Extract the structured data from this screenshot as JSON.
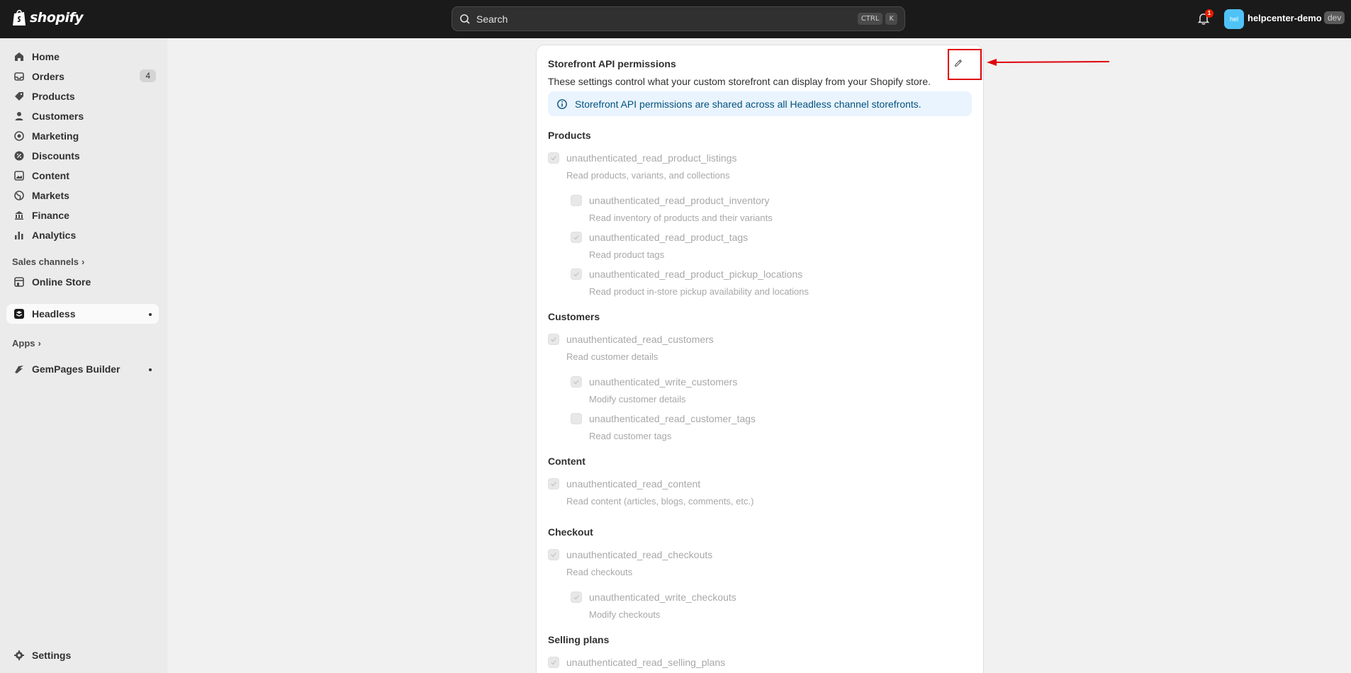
{
  "topbar": {
    "logo_text": "shopify",
    "search_placeholder": "Search",
    "shortcut_keys": [
      "CTRL",
      "K"
    ],
    "notification_count": "1",
    "avatar_initials": "hel",
    "store_name": "helpcenter-demo",
    "dev_badge": "dev"
  },
  "sidebar": {
    "items": [
      {
        "label": "Home",
        "icon": "home-icon"
      },
      {
        "label": "Orders",
        "icon": "inbox-icon",
        "count": "4"
      },
      {
        "label": "Products",
        "icon": "tag-icon"
      },
      {
        "label": "Customers",
        "icon": "person-icon"
      },
      {
        "label": "Marketing",
        "icon": "target-icon"
      },
      {
        "label": "Discounts",
        "icon": "discount-icon"
      },
      {
        "label": "Content",
        "icon": "image-icon"
      },
      {
        "label": "Markets",
        "icon": "globe-icon"
      },
      {
        "label": "Finance",
        "icon": "bank-icon"
      },
      {
        "label": "Analytics",
        "icon": "bar-chart-icon"
      }
    ],
    "sales_channels_label": "Sales channels",
    "online_store_label": "Online Store",
    "headless_label": "Headless",
    "apps_label": "Apps",
    "gempages_label": "GemPages Builder",
    "settings_label": "Settings"
  },
  "card": {
    "title": "Storefront API permissions",
    "description": "These settings control what your custom storefront can display from your Shopify store.",
    "info_banner": "Storefront API permissions are shared across all Headless channel storefronts.",
    "groups": [
      {
        "title": "Products",
        "perms": [
          {
            "name": "unauthenticated_read_product_listings",
            "desc": "Read products, variants, and collections",
            "checked": true,
            "indent": false
          },
          {
            "name": "unauthenticated_read_product_inventory",
            "desc": "Read inventory of products and their variants",
            "checked": false,
            "indent": true
          },
          {
            "name": "unauthenticated_read_product_tags",
            "desc": "Read product tags",
            "checked": true,
            "indent": true
          },
          {
            "name": "unauthenticated_read_product_pickup_locations",
            "desc": "Read product in-store pickup availability and locations",
            "checked": true,
            "indent": true
          }
        ]
      },
      {
        "title": "Customers",
        "perms": [
          {
            "name": "unauthenticated_read_customers",
            "desc": "Read customer details",
            "checked": true,
            "indent": false
          },
          {
            "name": "unauthenticated_write_customers",
            "desc": "Modify customer details",
            "checked": true,
            "indent": true
          },
          {
            "name": "unauthenticated_read_customer_tags",
            "desc": "Read customer tags",
            "checked": false,
            "indent": true
          }
        ]
      },
      {
        "title": "Content",
        "perms": [
          {
            "name": "unauthenticated_read_content",
            "desc": "Read content (articles, blogs, comments, etc.)",
            "checked": true,
            "indent": false
          }
        ]
      },
      {
        "title": "Checkout",
        "perms": [
          {
            "name": "unauthenticated_read_checkouts",
            "desc": "Read checkouts",
            "checked": true,
            "indent": false
          },
          {
            "name": "unauthenticated_write_checkouts",
            "desc": "Modify checkouts",
            "checked": true,
            "indent": true
          }
        ]
      },
      {
        "title": "Selling plans",
        "perms": [
          {
            "name": "unauthenticated_read_selling_plans",
            "desc": "",
            "checked": true,
            "indent": false
          }
        ]
      }
    ]
  },
  "colors": {
    "topbar_bg": "#1a1a1a",
    "annotation_red": "#e0000a",
    "info_bg": "#eaf4ff",
    "avatar_bg": "#4fc3f7"
  }
}
